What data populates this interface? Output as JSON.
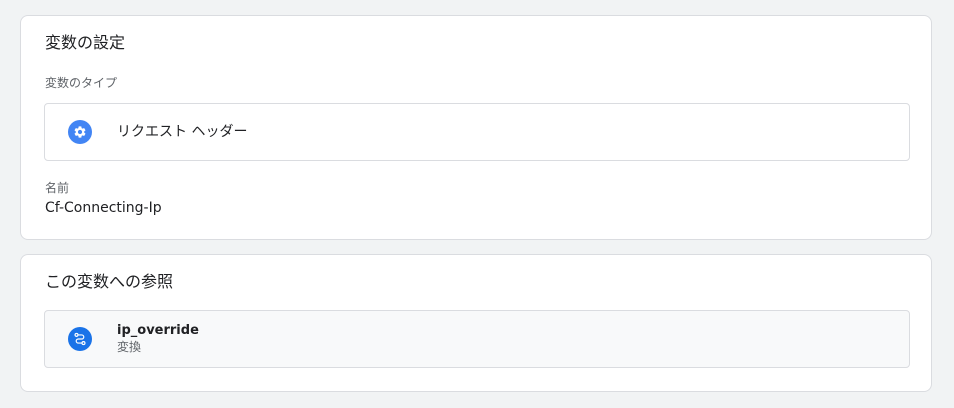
{
  "variable_settings": {
    "title": "変数の設定",
    "type_label": "変数のタイプ",
    "type": {
      "name": "リクエスト ヘッダー",
      "icon": "gear-icon",
      "icon_color": "#4285f4"
    },
    "name_label": "名前",
    "name_value": "Cf-Connecting-Ip"
  },
  "references": {
    "title": "この変数への参照",
    "items": [
      {
        "name": "ip_override",
        "type": "変換",
        "icon": "transform-icon",
        "icon_color": "#1a73e8"
      }
    ]
  }
}
